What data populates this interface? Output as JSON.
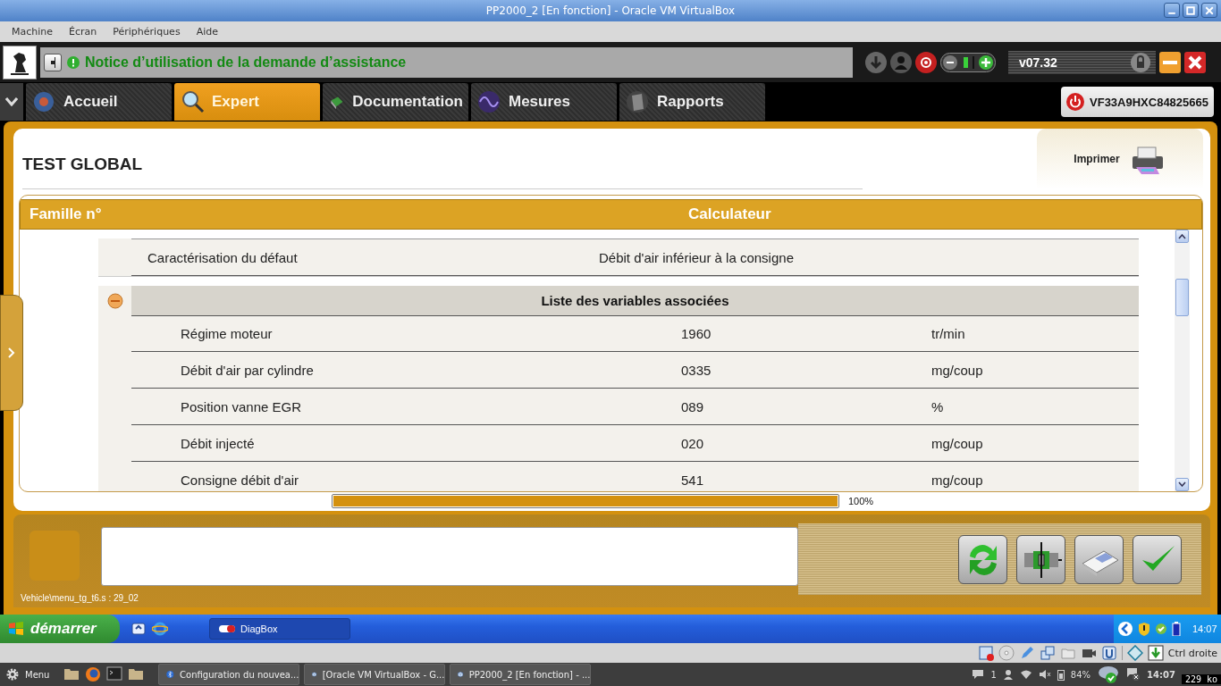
{
  "window": {
    "title": "PP2000_2 [En fonction] - Oracle VM VirtualBox"
  },
  "menu": [
    "Machine",
    "Écran",
    "Périphériques",
    "Aide"
  ],
  "app": {
    "notice": "Notice d’utilisation de la demande d’assistance",
    "version": "v07.32",
    "vin": "VF33A9HXC84825665",
    "tabs": [
      {
        "label": "Accueil",
        "selected": false
      },
      {
        "label": "Expert",
        "selected": true
      },
      {
        "label": "Documentation",
        "selected": false
      },
      {
        "label": "Mesures",
        "selected": false
      },
      {
        "label": "Rapports",
        "selected": false
      }
    ]
  },
  "page": {
    "title": "TEST GLOBAL",
    "print_label": "Imprimer",
    "table": {
      "columns": [
        "Famille n°",
        "Calculateur"
      ],
      "defect": {
        "label": "Caractérisation du défaut",
        "value": "Débit d'air inférieur à la consigne"
      },
      "variables": {
        "title": "Liste des variables associées",
        "expanded": true,
        "rows": [
          {
            "name": "Régime moteur",
            "value": "1960",
            "unit": "tr/min"
          },
          {
            "name": "Débit d'air par cylindre",
            "value": "0335",
            "unit": "mg/coup"
          },
          {
            "name": "Position vanne EGR",
            "value": "089",
            "unit": "%"
          },
          {
            "name": "Débit injecté",
            "value": "020",
            "unit": "mg/coup"
          },
          {
            "name": "Consigne débit d'air",
            "value": "541",
            "unit": "mg/coup"
          }
        ]
      }
    },
    "progress": {
      "level": 1,
      "reading": "100%"
    }
  },
  "bottom": {
    "path": "Vehicle\\menu_tg_t6.s : 29_02"
  },
  "xp_taskbar": {
    "start": "démarrer",
    "task": "DiagBox",
    "clock": "14:07"
  },
  "vbox_status": {
    "host_key": "Ctrl droite"
  },
  "panel": {
    "menu": "Menu",
    "tasks": [
      "Configuration du nouvea...",
      "[Oracle VM VirtualBox - G...",
      "PP2000_2 [En fonction] - ..."
    ],
    "notifications": "1",
    "battery": "84%",
    "clock": "14:07",
    "net": "229 ko"
  }
}
